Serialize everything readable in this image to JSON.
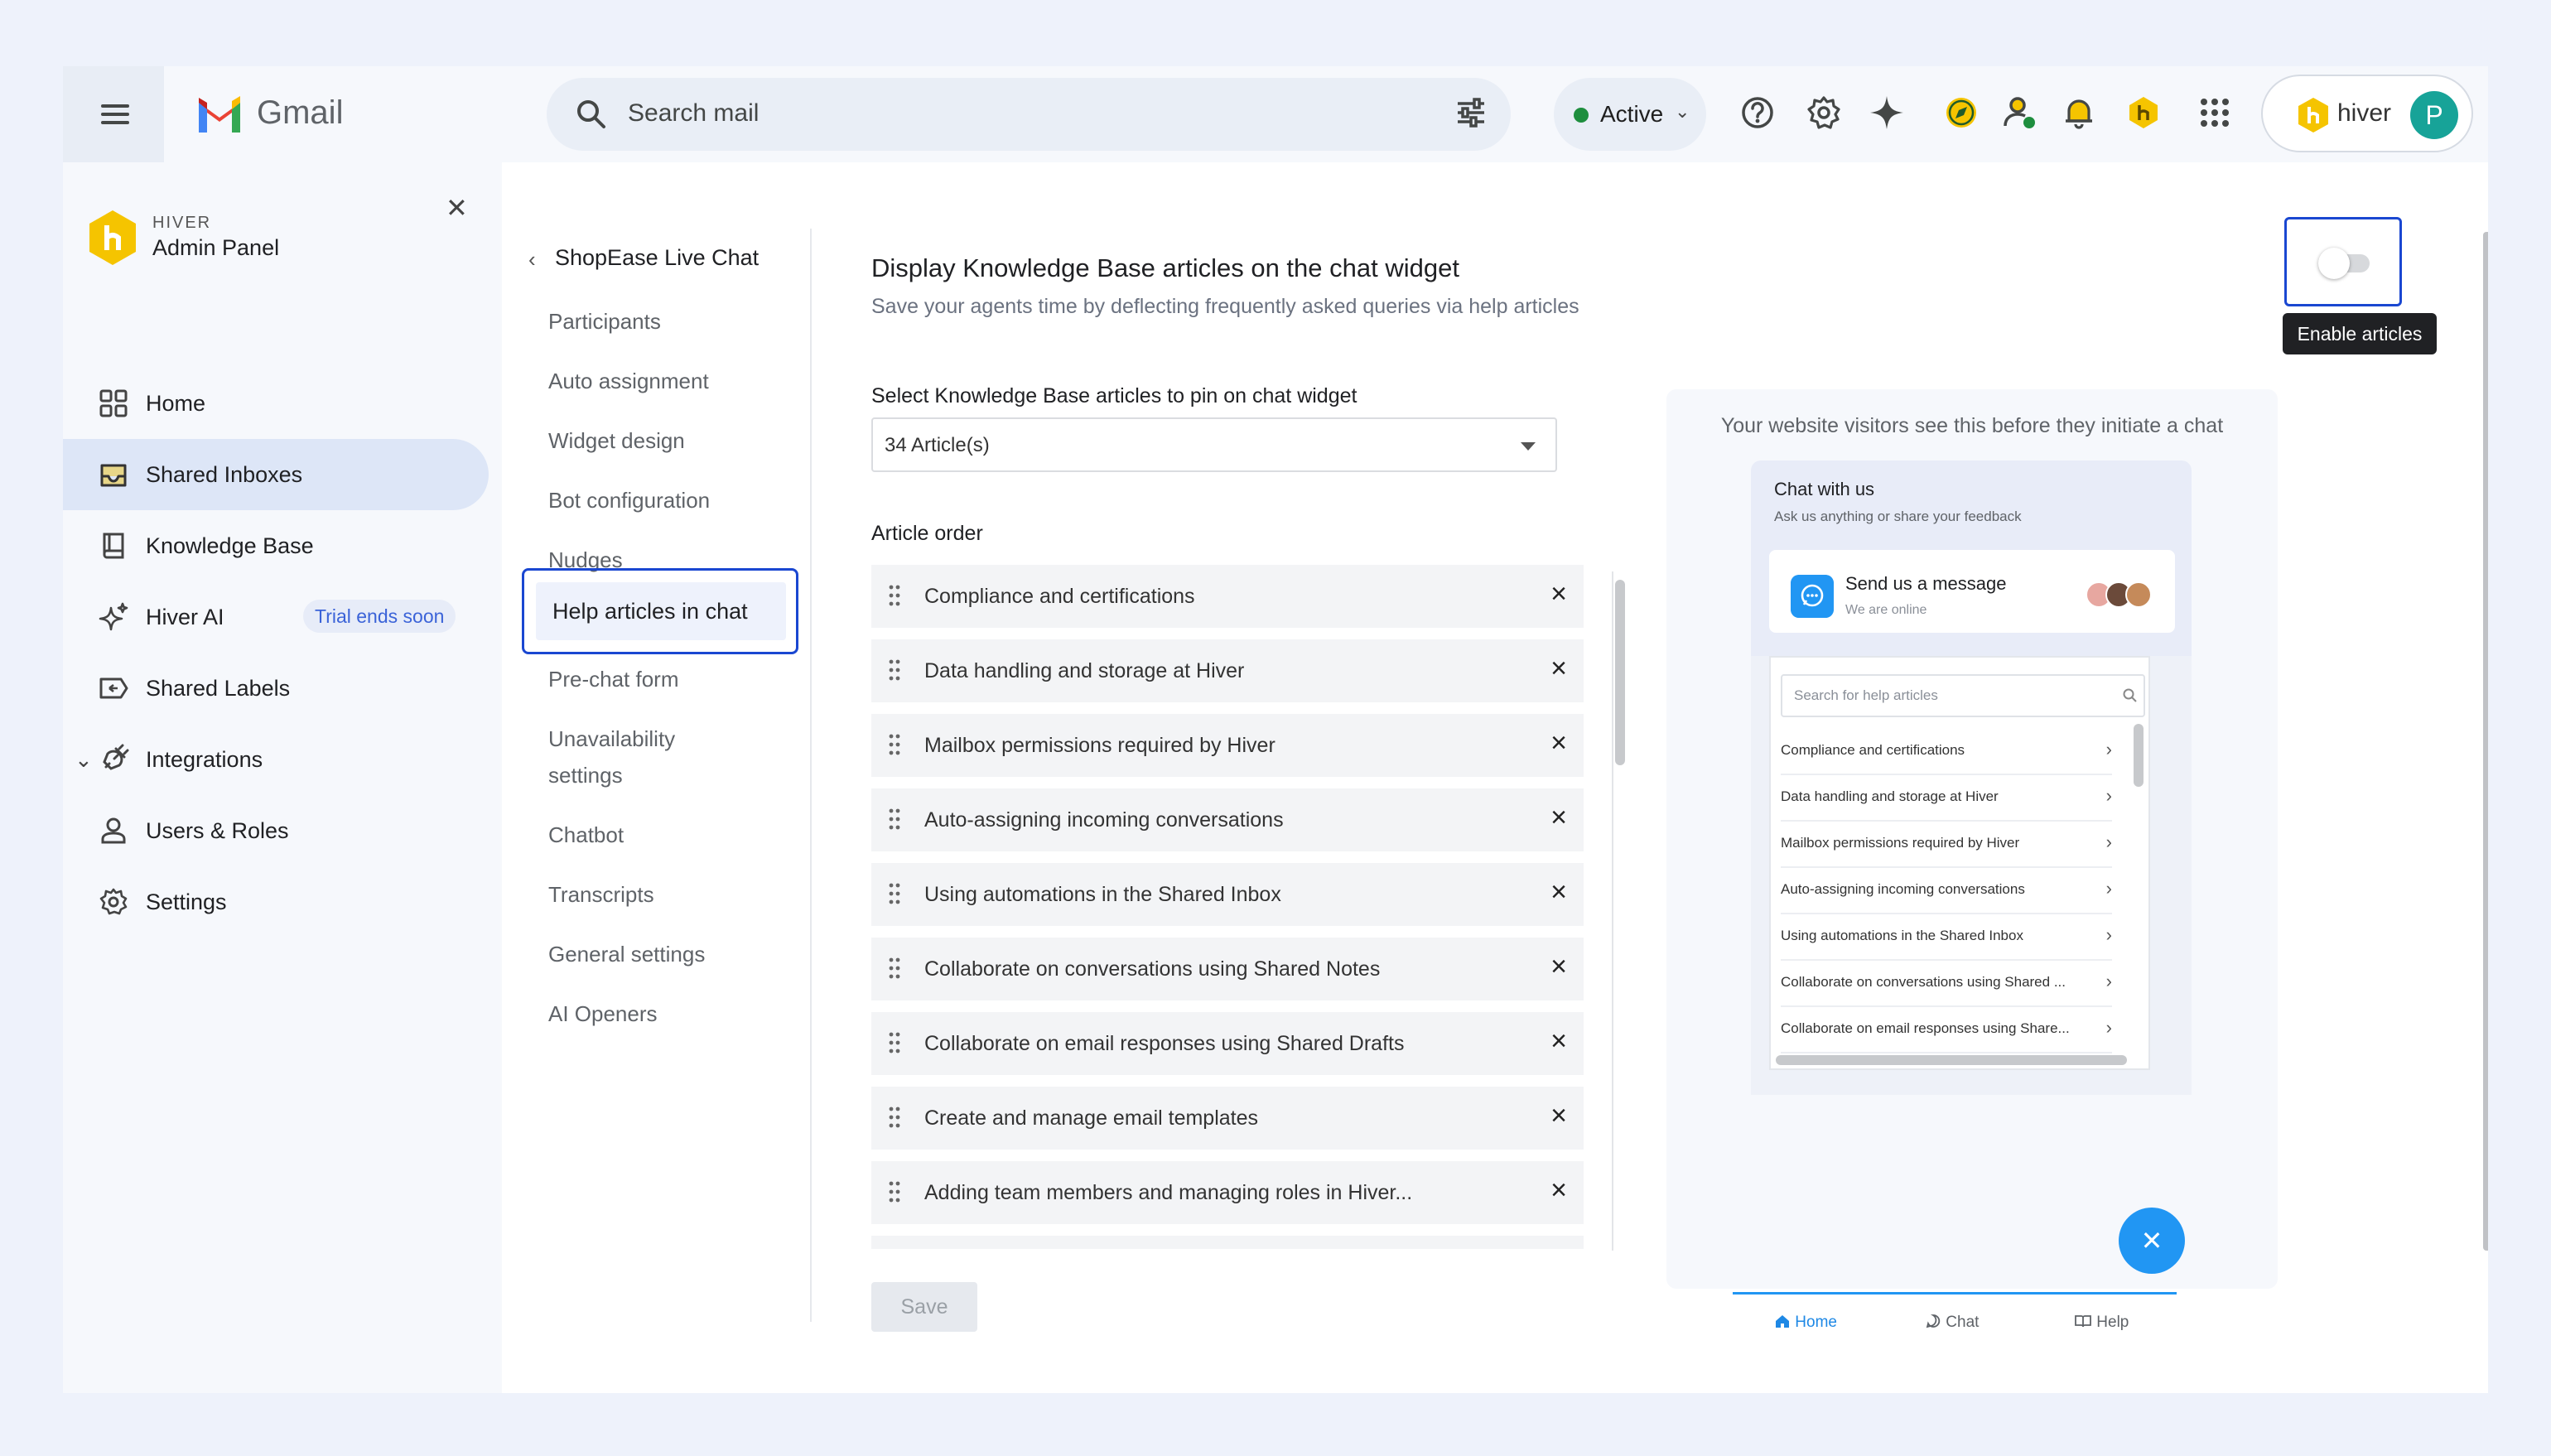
{
  "topbar": {
    "app_name": "Gmail",
    "search_placeholder": "Search mail",
    "status": "Active",
    "hiver_label": "hiver",
    "avatar_initial": "P"
  },
  "sidebar": {
    "brand_small": "HIVER",
    "brand_title": "Admin Panel",
    "items": [
      {
        "label": "Home",
        "icon": "grid-icon"
      },
      {
        "label": "Shared Inboxes",
        "icon": "inbox-icon",
        "active": true
      },
      {
        "label": "Knowledge Base",
        "icon": "book-icon"
      },
      {
        "label": "Hiver AI",
        "icon": "sparkle-icon",
        "badge": "Trial ends soon"
      },
      {
        "label": "Shared Labels",
        "icon": "label-icon"
      },
      {
        "label": "Integrations",
        "icon": "plug-icon",
        "expandable": true
      },
      {
        "label": "Users & Roles",
        "icon": "user-icon"
      },
      {
        "label": "Settings",
        "icon": "gear-icon"
      }
    ]
  },
  "subnav": {
    "back_label": "ShopEase Live Chat",
    "items": [
      "Participants",
      "Auto assignment",
      "Widget design",
      "Bot configuration",
      "Nudges",
      "Help articles in chat",
      "Pre-chat form",
      "Unavailability",
      "settings",
      "Chatbot",
      "Transcripts",
      "General settings",
      "AI Openers"
    ]
  },
  "main": {
    "title": "Display Knowledge Base articles on the chat widget",
    "subtitle": "Save your agents time by deflecting frequently asked queries via help articles",
    "select_label": "Select Knowledge Base articles to pin on chat widget",
    "select_value": "34 Article(s)",
    "order_label": "Article order",
    "articles": [
      "Compliance and certifications",
      "Data handling and storage at Hiver",
      "Mailbox permissions required by Hiver",
      "Auto-assigning incoming conversations",
      "Using automations in the Shared Inbox",
      "Collaborate on conversations using Shared Notes",
      "Collaborate on email responses using Shared Drafts",
      "Create and manage email templates",
      "Adding team members and managing roles in Hiver..."
    ],
    "save_label": "Save",
    "toggle_tooltip": "Enable articles"
  },
  "preview": {
    "caption": "Your website visitors see this before they initiate a chat",
    "widget_title": "Chat with us",
    "widget_sub": "Ask us anything or share your feedback",
    "message_title": "Send us a message",
    "message_sub": "We are online",
    "search_placeholder": "Search for help articles",
    "help_items": [
      "Compliance and certifications",
      "Data handling and storage at Hiver",
      "Mailbox permissions required by Hiver",
      "Auto-assigning incoming conversations",
      "Using automations in the Shared Inbox",
      "Collaborate on conversations using Shared ...",
      "Collaborate on email responses using Share..."
    ],
    "tabs": [
      "Home",
      "Chat",
      "Help"
    ]
  },
  "colors": {
    "accent_blue": "#1a47d1",
    "widget_blue": "#2196f3",
    "hiver_yellow": "#f5c400",
    "status_green": "#1e8e3e"
  }
}
